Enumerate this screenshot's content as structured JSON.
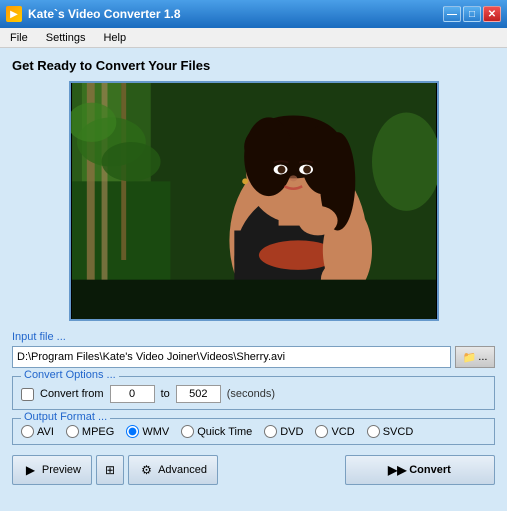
{
  "window": {
    "title": "Kate`s Video Converter 1.8",
    "controls": {
      "minimize": "—",
      "maximize": "□",
      "close": "✕"
    }
  },
  "menu": {
    "items": [
      {
        "label": "File"
      },
      {
        "label": "Settings"
      },
      {
        "label": "Help"
      }
    ]
  },
  "page": {
    "title": "Get Ready to Convert Your Files"
  },
  "input_file": {
    "label": "Input file ...",
    "value": "D:\\Program Files\\Kate's Video Joiner\\Videos\\Sherry.avi",
    "browse_label": "..."
  },
  "convert_options": {
    "label": "Convert Options ...",
    "checkbox_label": "Convert from",
    "from_value": "0",
    "to_value": "502",
    "seconds_label": "(seconds)"
  },
  "output_format": {
    "label": "Output Format ...",
    "options": [
      {
        "id": "avi",
        "label": "AVI",
        "checked": false
      },
      {
        "id": "mpeg",
        "label": "MPEG",
        "checked": false
      },
      {
        "id": "wmv",
        "label": "WMV",
        "checked": true
      },
      {
        "id": "quicktime",
        "label": "Quick Time",
        "checked": false
      },
      {
        "id": "dvd",
        "label": "DVD",
        "checked": false
      },
      {
        "id": "vcd",
        "label": "VCD",
        "checked": false
      },
      {
        "id": "svcd",
        "label": "SVCD",
        "checked": false
      }
    ]
  },
  "buttons": {
    "preview": "Preview",
    "advanced": "Advanced",
    "convert": "Convert"
  }
}
